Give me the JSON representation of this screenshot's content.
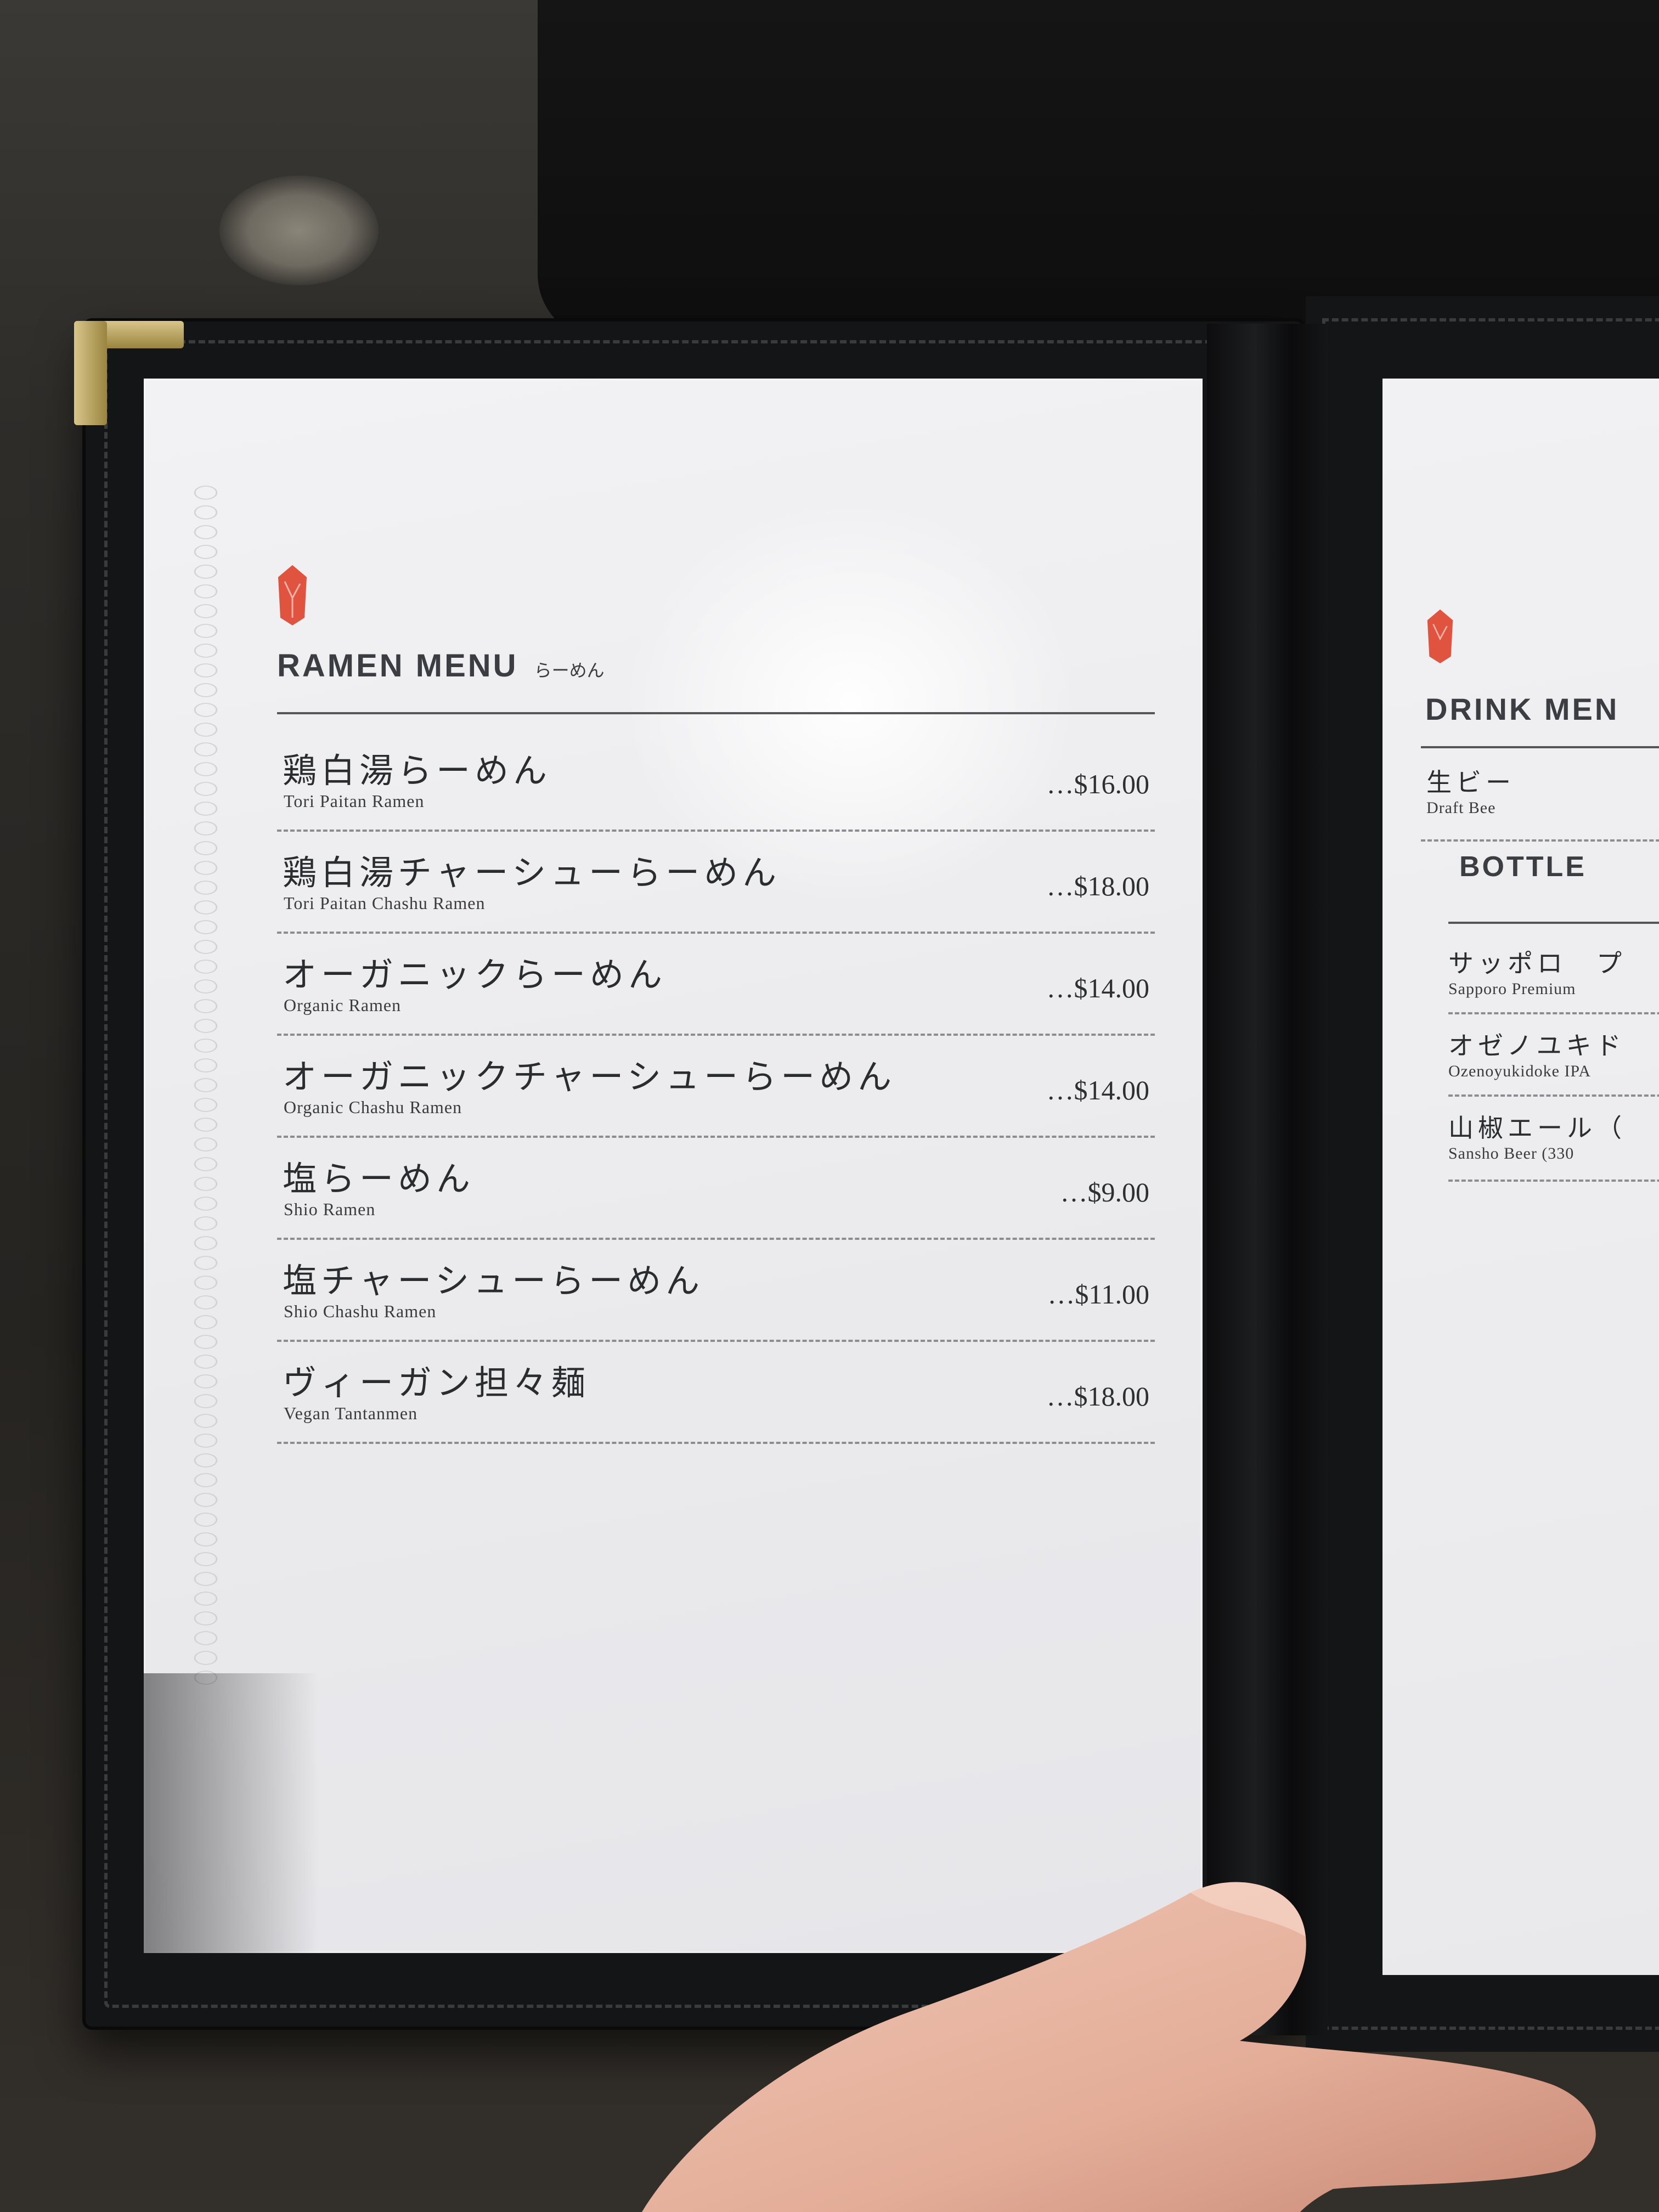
{
  "menu": {
    "title": "RAMEN MENU",
    "title_jp": "らーめん",
    "items": [
      {
        "name_jp": "鶏白湯らーめん",
        "name_en": "Tori Paitan Ramen",
        "price": "…$16.00"
      },
      {
        "name_jp": "鶏白湯チャーシューらーめん",
        "name_en": "Tori Paitan Chashu Ramen",
        "price": "…$18.00"
      },
      {
        "name_jp": "オーガニックらーめん",
        "name_en": "Organic Ramen",
        "price": "…$14.00"
      },
      {
        "name_jp": "オーガニックチャーシューらーめん",
        "name_en": "Organic Chashu Ramen",
        "price": "…$14.00"
      },
      {
        "name_jp": "塩らーめん",
        "name_en": "Shio Ramen",
        "price": "…$9.00"
      },
      {
        "name_jp": "塩チャーシューらーめん",
        "name_en": "Shio Chashu Ramen",
        "price": "…$11.00"
      },
      {
        "name_jp": "ヴィーガン担々麺",
        "name_en": "Vegan Tantanmen",
        "price": "…$18.00"
      }
    ]
  },
  "right_page": {
    "title": "DRINK MEN",
    "draft_jp": "生ビー",
    "draft_en": "Draft Bee",
    "section": "BOTTLE",
    "rows": [
      {
        "jp": "サッポロ　プ",
        "en": "Sapporo Premium"
      },
      {
        "jp": "オゼノユキド",
        "en": "Ozenoyukidoke IPA"
      },
      {
        "jp": "山椒エール（",
        "en": "Sansho Beer (330"
      }
    ]
  },
  "colors": {
    "accent": "#e0533f",
    "text": "#2b2c30",
    "folder": "#141516"
  }
}
